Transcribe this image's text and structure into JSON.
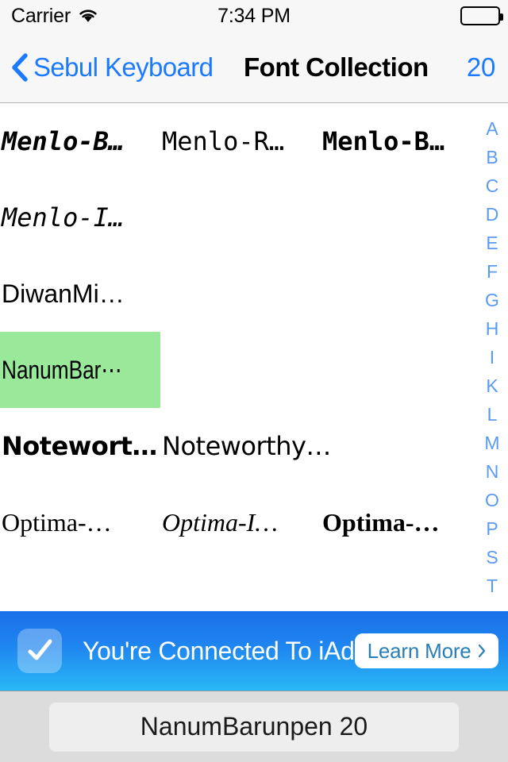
{
  "status_bar": {
    "carrier": "Carrier",
    "wifi_icon": "wifi-icon",
    "time": "7:34 PM",
    "battery_icon": "battery-full-icon"
  },
  "nav_bar": {
    "back_icon": "chevron-left-icon",
    "back_label": "Sebul Keyboard",
    "title": "Font Collection",
    "right_label": "20"
  },
  "grid": {
    "rows": [
      {
        "cells": [
          {
            "label": "Menlo-B…",
            "style": "mono-bold-italic",
            "selected": false
          },
          {
            "label": "Menlo-R…",
            "style": "mono",
            "selected": false
          },
          {
            "label": "Menlo-B…",
            "style": "mono-bold",
            "selected": false
          }
        ]
      },
      {
        "cells": [
          {
            "label": "Menlo-I…",
            "style": "mono-italic",
            "selected": false
          },
          {
            "label": "",
            "style": "empty",
            "selected": false
          },
          {
            "label": "",
            "style": "empty",
            "selected": false
          }
        ]
      },
      {
        "cells": [
          {
            "label": "DiwanMi…",
            "style": "sans",
            "selected": false
          },
          {
            "label": "",
            "style": "empty",
            "selected": false
          },
          {
            "label": "",
            "style": "empty",
            "selected": false
          }
        ]
      },
      {
        "cells": [
          {
            "label": "NanumBar⋯",
            "style": "narrow",
            "selected": true
          },
          {
            "label": "",
            "style": "empty",
            "selected": false
          },
          {
            "label": "",
            "style": "empty",
            "selected": false
          }
        ]
      },
      {
        "cells": [
          {
            "label": "Notewort…",
            "style": "hand-bold",
            "selected": false
          },
          {
            "label": "Noteworthy…",
            "style": "hand",
            "selected": false
          },
          {
            "label": "",
            "style": "empty",
            "selected": false
          }
        ]
      },
      {
        "cells": [
          {
            "label": "Optima-…",
            "style": "serif",
            "selected": false
          },
          {
            "label": "Optima-I…",
            "style": "serif-italic",
            "selected": false
          },
          {
            "label": "Optima-…",
            "style": "serif-bold",
            "selected": false
          }
        ]
      }
    ]
  },
  "index_strip": {
    "letters": [
      "A",
      "B",
      "C",
      "D",
      "E",
      "F",
      "G",
      "H",
      "I",
      "K",
      "L",
      "M",
      "N",
      "O",
      "P",
      "S",
      "T"
    ]
  },
  "ad_banner": {
    "check_icon": "checkmark-icon",
    "text": "You're Connected To iAd",
    "button_label": "Learn More",
    "button_chevron_icon": "chevron-right-icon"
  },
  "toolbar": {
    "field_value": "NanumBarunpen 20"
  },
  "colors": {
    "tint_blue": "#1b7aff",
    "index_blue": "#5a9bf0",
    "selection_green": "#9ae89a",
    "ad_blue_top": "#1a6fe8",
    "ad_blue_bottom": "#29b8f5",
    "toolbar_gray": "#dcdcdc"
  }
}
